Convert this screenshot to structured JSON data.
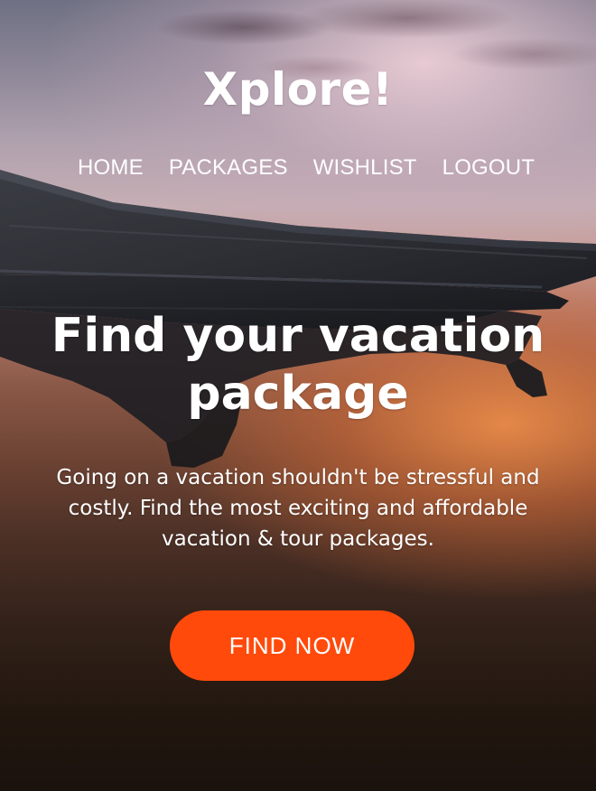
{
  "brand": {
    "name": "Xplore!"
  },
  "nav": {
    "items": [
      "HOME",
      "PACKAGES",
      "WISHLIST",
      "LOGOUT"
    ]
  },
  "hero": {
    "headline": "Find your vacation package",
    "lead": "Going on a vacation shouldn't be stressful and costly. Find the most exciting and affordable vacation & tour packages.",
    "cta_label": "FIND NOW"
  },
  "colors": {
    "cta": "#ff4a0b",
    "text": "#ffffff"
  }
}
